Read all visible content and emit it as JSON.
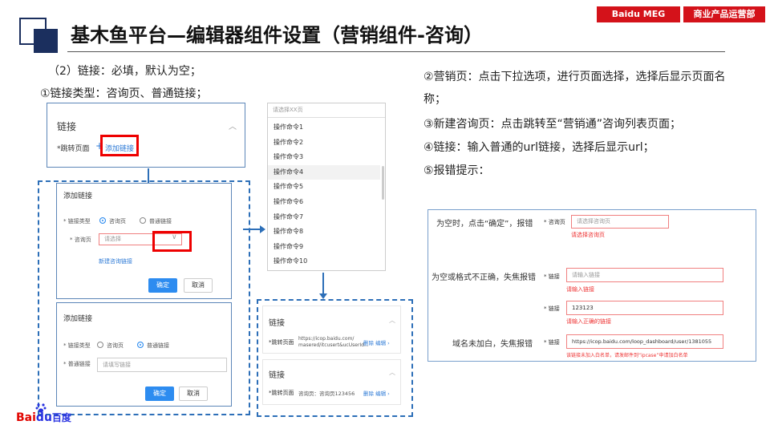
{
  "header": {
    "title": "基木鱼平台—编辑器组件设置（营销组件-咨询）",
    "tag_dept1": "Baidu MEG",
    "tag_dept2": "商业产品运营部"
  },
  "left_text": {
    "line1": "（2）链接：必填，默认为空；",
    "line2": "①链接类型：咨询页、普通链接；"
  },
  "right_text": {
    "p1": "②营销页：点击下拉选项，进行页面选择，选择后显示页面名称；",
    "p2": "③新建咨询页：点击跳转至“营销通”咨询列表页面；",
    "p3": "④链接：输入普通的url链接，选择后显示url；",
    "p4": "⑤报错提示："
  },
  "card_link": {
    "title": "链接",
    "label": "*跳转页面",
    "plus": "+",
    "add": "添加链接",
    "chevron": "︿"
  },
  "dialog1": {
    "title": "添加链接",
    "type_label": "* 链接类型",
    "opt1": "咨询页",
    "opt2": "普通链接",
    "page_label": "* 咨询页",
    "placeholder": "请选择",
    "new_link": "新建咨询链接",
    "ok": "确定",
    "cancel": "取消"
  },
  "dialog2": {
    "title": "添加链接",
    "type_label": "* 链接类型",
    "opt1": "咨询页",
    "opt2": "普通链接",
    "link_label": "* 普通链接",
    "placeholder": "请填写链接",
    "ok": "确定",
    "cancel": "取消"
  },
  "dropdown": {
    "placeholder": "请选择XX页",
    "items": [
      "操作命令1",
      "操作命令2",
      "操作命令3",
      "操作命令4",
      "操作命令5",
      "操作命令6",
      "操作命令7",
      "操作命令8",
      "操作命令9",
      "操作命令10"
    ]
  },
  "result1": {
    "title": "链接",
    "label": "*跳转页面",
    "value_l1": "https://icop.baidu.com/",
    "value_l2": "masered/itcusert&ucUserId...",
    "edit_actions": "删除  编辑 ›"
  },
  "result2": {
    "title": "链接",
    "label": "*跳转页面",
    "value": "咨询页：咨询页123456",
    "edit_actions": "删除  编辑 ›"
  },
  "errors": {
    "e1_desc": "为空时，点击“确定”，报错",
    "e1_label": "* 咨询页",
    "e1_placeholder": "请选择咨询页",
    "e1_msg": "请选择咨询页",
    "e2_desc": "为空或格式不正确，失焦报错",
    "e2_label": "* 链接",
    "e2_placeholder": "请输入链接",
    "e2_msg": "请输入链接",
    "e3_label": "* 链接",
    "e3_value": "123123",
    "e3_msg": "请输入正确的链接",
    "e4_desc": "域名未加白，失焦报错",
    "e4_label": "* 链接",
    "e4_value": "https://icop.baidu.com/loop_dashboard/user/1381055",
    "e4_msg": "该链接未加入白名单，请发邮件到“ipcase”申请加白名单"
  },
  "footer": {
    "logo_text": "Bai",
    "logo_text2": "du",
    "logo_cn": "百度"
  }
}
